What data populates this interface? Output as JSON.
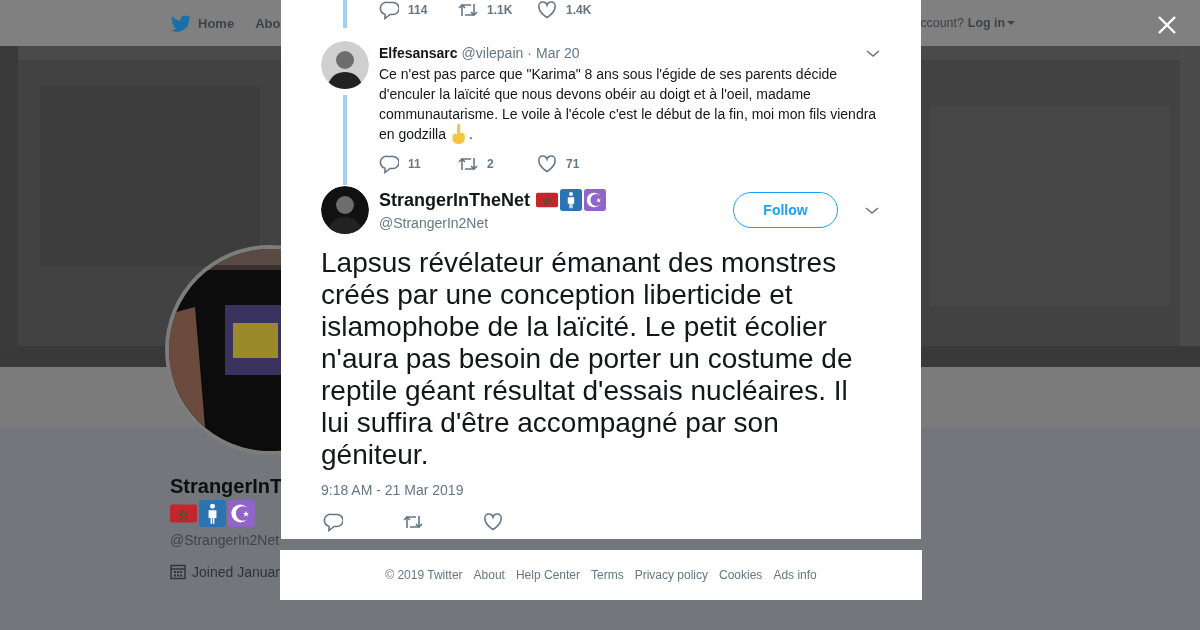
{
  "top_nav": {
    "items": [
      {
        "label": "Home",
        "kind": "home"
      },
      {
        "label": "Abo",
        "kind": "link"
      }
    ],
    "account_prompt": "ccount?",
    "login": "Log in"
  },
  "profile": {
    "name": "StrangerInT",
    "badges": [
      {
        "kind": "flag"
      },
      {
        "kind": "person"
      },
      {
        "kind": "crescent"
      }
    ],
    "handle": "@StrangerIn2Net",
    "joined": "Joined Januar"
  },
  "modal": {
    "previous_tweet_stats": {
      "replies": "114",
      "retweets": "1.1K",
      "likes": "1.4K"
    },
    "reply": {
      "name": "Elfesansarc",
      "handle": "@vilepain",
      "separator": "·",
      "date": "Mar 20",
      "text": "Ce n'est pas parce que \"Karima\" 8 ans sous l'égide de ses parents décide d'enculer la laïcité que nous devons obéir au doigt et à l'oeil, madame communautarisme. Le voile à l'école c'est le début de la fin, moi mon fils viendra",
      "text_last_line": "en godzilla",
      "text_end": ".",
      "stats": {
        "replies": "11",
        "retweets": "2",
        "likes": "71"
      }
    },
    "tweet": {
      "name": "StrangerInTheNet",
      "badges": [
        {
          "kind": "flag"
        },
        {
          "kind": "person"
        },
        {
          "kind": "crescent"
        }
      ],
      "handle": "@StrangerIn2Net",
      "follow_label": "Follow",
      "text": "Lapsus révélateur émanant des monstres créés par une conception liberticide et islamophobe de la laïcité. Le petit écolier n'aura pas besoin de porter un costume de reptile géant résultat d'essais nucléaires. Il lui suffira d'être accompagné par son géniteur.",
      "timestamp": "9:18 AM - 21 Mar 2019"
    }
  },
  "footer": {
    "copyright": "© 2019 Twitter",
    "links": [
      "About",
      "Help Center",
      "Terms",
      "Privacy policy",
      "Cookies",
      "Ads info"
    ]
  }
}
